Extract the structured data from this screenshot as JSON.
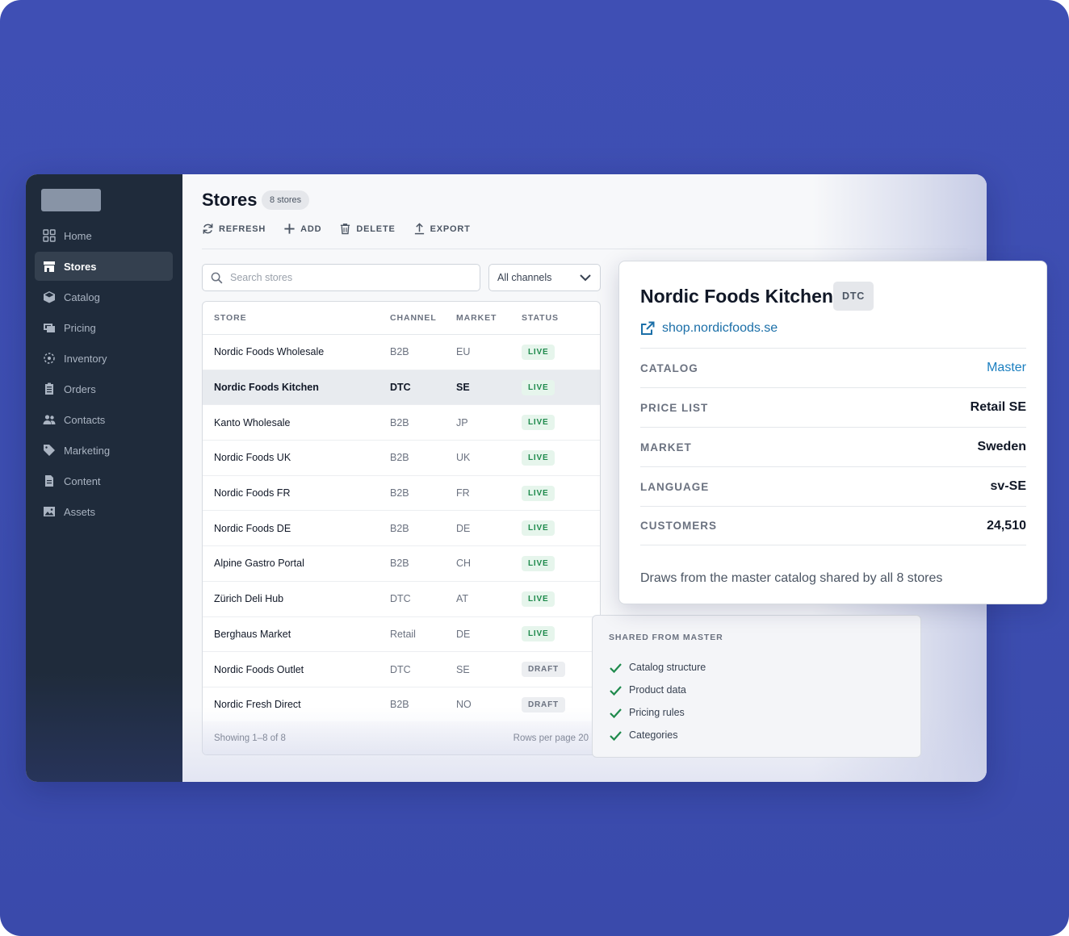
{
  "sidebar": {
    "items": [
      {
        "label": "Home",
        "icon": "grid-icon"
      },
      {
        "label": "Stores",
        "icon": "store-icon",
        "active": true
      },
      {
        "label": "Catalog",
        "icon": "box-icon"
      },
      {
        "label": "Pricing",
        "icon": "pricing-icon"
      },
      {
        "label": "Inventory",
        "icon": "inventory-icon"
      },
      {
        "label": "Orders",
        "icon": "clipboard-icon"
      },
      {
        "label": "Contacts",
        "icon": "people-icon"
      },
      {
        "label": "Marketing",
        "icon": "tag-icon"
      },
      {
        "label": "Content",
        "icon": "document-icon"
      },
      {
        "label": "Assets",
        "icon": "image-icon"
      }
    ]
  },
  "header": {
    "title": "Stores",
    "count_badge": "8 stores"
  },
  "toolbar": {
    "refresh_label": "REFRESH",
    "add_label": "ADD",
    "delete_label": "DELETE",
    "export_label": "EXPORT"
  },
  "search": {
    "placeholder": "Search stores",
    "value": ""
  },
  "channel_filter": {
    "selected": "All channels"
  },
  "table": {
    "columns": [
      "STORE",
      "CHANNEL",
      "MARKET",
      "STATUS"
    ],
    "rows": [
      {
        "store": "Nordic Foods Wholesale",
        "channel": "B2B",
        "market": "EU",
        "status": "LIVE"
      },
      {
        "store": "Nordic Foods Kitchen",
        "channel": "DTC",
        "market": "SE",
        "status": "LIVE",
        "selected": true
      },
      {
        "store": "Kanto Wholesale",
        "channel": "B2B",
        "market": "JP",
        "status": "LIVE"
      },
      {
        "store": "Nordic Foods UK",
        "channel": "B2B",
        "market": "UK",
        "status": "LIVE"
      },
      {
        "store": "Nordic Foods FR",
        "channel": "B2B",
        "market": "FR",
        "status": "LIVE"
      },
      {
        "store": "Nordic Foods DE",
        "channel": "B2B",
        "market": "DE",
        "status": "LIVE"
      },
      {
        "store": "Alpine Gastro Portal",
        "channel": "B2B",
        "market": "CH",
        "status": "LIVE"
      },
      {
        "store": "Zürich Deli Hub",
        "channel": "DTC",
        "market": "AT",
        "status": "LIVE"
      },
      {
        "store": "Berghaus Market",
        "channel": "Retail",
        "market": "DE",
        "status": "LIVE"
      },
      {
        "store": "Nordic Foods Outlet",
        "channel": "DTC",
        "market": "SE",
        "status": "DRAFT"
      },
      {
        "store": "Nordic Fresh Direct",
        "channel": "B2B",
        "market": "NO",
        "status": "DRAFT"
      }
    ],
    "footer_left": "Showing 1–8 of 8",
    "footer_right": "Rows per page 20"
  },
  "detail": {
    "title": "Nordic Foods Kitchen",
    "badge": "DTC",
    "link": "shop.nordicfoods.se",
    "rows": [
      {
        "label": "CATALOG",
        "value": "Master",
        "is_link": true
      },
      {
        "label": "PRICE LIST",
        "value": "Retail SE"
      },
      {
        "label": "MARKET",
        "value": "Sweden"
      },
      {
        "label": "LANGUAGE",
        "value": "sv-SE"
      },
      {
        "label": "CUSTOMERS",
        "value": "24,510"
      }
    ],
    "note": "Draws from the master catalog shared by all 8 stores"
  },
  "shared": {
    "title": "SHARED FROM MASTER",
    "items": [
      "Catalog structure",
      "Product data",
      "Pricing rules",
      "Categories"
    ]
  },
  "colors": {
    "backdrop": "#3e4eb2",
    "sidebar": "#1f2b3b",
    "live_green": "#1e8a4c",
    "link_blue": "#1b6fa8",
    "check_green": "#1e8a4c"
  }
}
